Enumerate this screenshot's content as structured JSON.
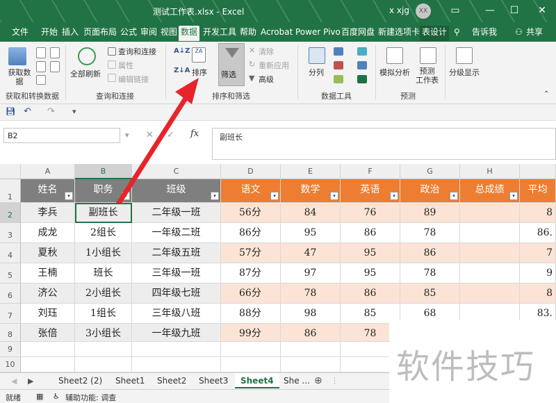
{
  "title": {
    "doc": "测试工作表.xlsx  -  Excel",
    "user": "x xjg",
    "avatar": "XX"
  },
  "ribbon_tabs": [
    "文件",
    "开始",
    "插入",
    "页面布局",
    "公式",
    "审阅",
    "视图",
    "数据",
    "开发工具",
    "帮助",
    "Acrobat",
    "Power Pivo",
    "百度网盘",
    "新建选项卡",
    "表设计"
  ],
  "active_tab": "数据",
  "tell_me": "告诉我",
  "share": "共享",
  "ribbon": {
    "get_data": "获取数\n据",
    "refresh_all": "全部刷新",
    "queries_connections": "查询和连接",
    "properties": "属性",
    "edit_links": "编辑链接",
    "sort": "排序",
    "filter": "筛选",
    "clear": "清除",
    "reapply": "重新应用",
    "advanced": "高级",
    "split": "分列",
    "whatif": "模拟分析",
    "forecast": "预测\n工作表",
    "outline": "分级显示",
    "group_get": "获取和转换数据",
    "group_query": "查询和连接",
    "group_sort": "排序和筛选",
    "group_tools": "数据工具",
    "group_forecast": "预测"
  },
  "namebox": "B2",
  "formula": "副班长",
  "columns": [
    "A",
    "B",
    "C",
    "D",
    "E",
    "F",
    "G",
    "H"
  ],
  "headers": [
    "姓名",
    "职务",
    "班级",
    "语文",
    "数学",
    "英语",
    "政治",
    "总成绩",
    "平均"
  ],
  "rows": [
    [
      "李兵",
      "副班长",
      "二年级一班",
      "56分",
      "84",
      "76",
      "89",
      "",
      "8"
    ],
    [
      "成龙",
      "2组长",
      "一年级二班",
      "86分",
      "95",
      "86",
      "78",
      "",
      "86."
    ],
    [
      "夏秋",
      "1小组长",
      "二年级五班",
      "57分",
      "47",
      "95",
      "86",
      "",
      "7"
    ],
    [
      "王楠",
      "班长",
      "三年级一班",
      "87分",
      "97",
      "95",
      "78",
      "",
      "9"
    ],
    [
      "济公",
      "2小组长",
      "四年级七班",
      "66分",
      "78",
      "86",
      "85",
      "",
      "8"
    ],
    [
      "刘珏",
      "1组长",
      "三年级八班",
      "88分",
      "98",
      "85",
      "68",
      "",
      "83."
    ],
    [
      "张倍",
      "3小组长",
      "一年级九班",
      "99分",
      "86",
      "78",
      "",
      "",
      ""
    ]
  ],
  "row_numbers": [
    "1",
    "2",
    "3",
    "4",
    "5",
    "6",
    "7",
    "8",
    "9",
    "10"
  ],
  "sheet_tabs": [
    "Sheet2 (2)",
    "Sheet1",
    "Sheet2",
    "Sheet3",
    "Sheet4",
    "She ..."
  ],
  "active_sheet": "Sheet4",
  "status": {
    "ready": "就绪",
    "accessibility": "辅助功能: 调查"
  },
  "watermark": "软件技巧",
  "colors": {
    "accent": "#217346",
    "orange_header": "#ED7D31",
    "orange_band": "#FBE4D5",
    "gray_header": "#7F7F7F",
    "gray_band": "#EDEDED",
    "arrow": "#E8242B"
  }
}
